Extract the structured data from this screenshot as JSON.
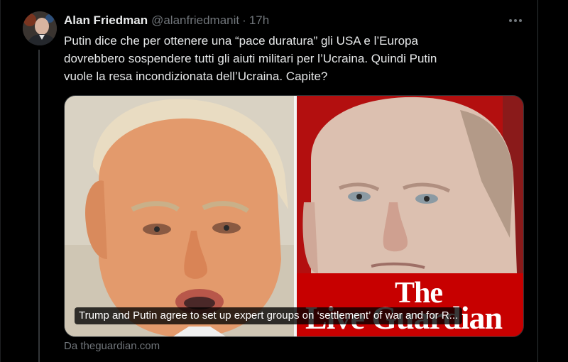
{
  "tweet": {
    "author_name": "Alan Friedman",
    "handle": "@alanfriedmanit",
    "separator": "·",
    "timestamp": "17h",
    "text_lines": [
      "Putin dice che per ottenere una “pace duratura” gli USA e l’Europa",
      "dovrebbero sospendere tutti gli aiuti militari per l’Ucraina. Quindi Putin",
      "vuole la resa incondizionata dell’Ucraina. Capite?"
    ]
  },
  "card": {
    "brand_the": "The",
    "brand_name": "Live Guardian",
    "caption": "Trump and Putin agree to set up expert groups on ‘settlement’ of war and for R...",
    "source": "Da theguardian.com"
  },
  "colors": {
    "background": "#000000",
    "text_primary": "#e7e9ea",
    "text_secondary": "#71767b",
    "border": "#2f3336",
    "guardian_red": "#c70000"
  },
  "icons": {
    "more": "more-horizontal-icon"
  }
}
